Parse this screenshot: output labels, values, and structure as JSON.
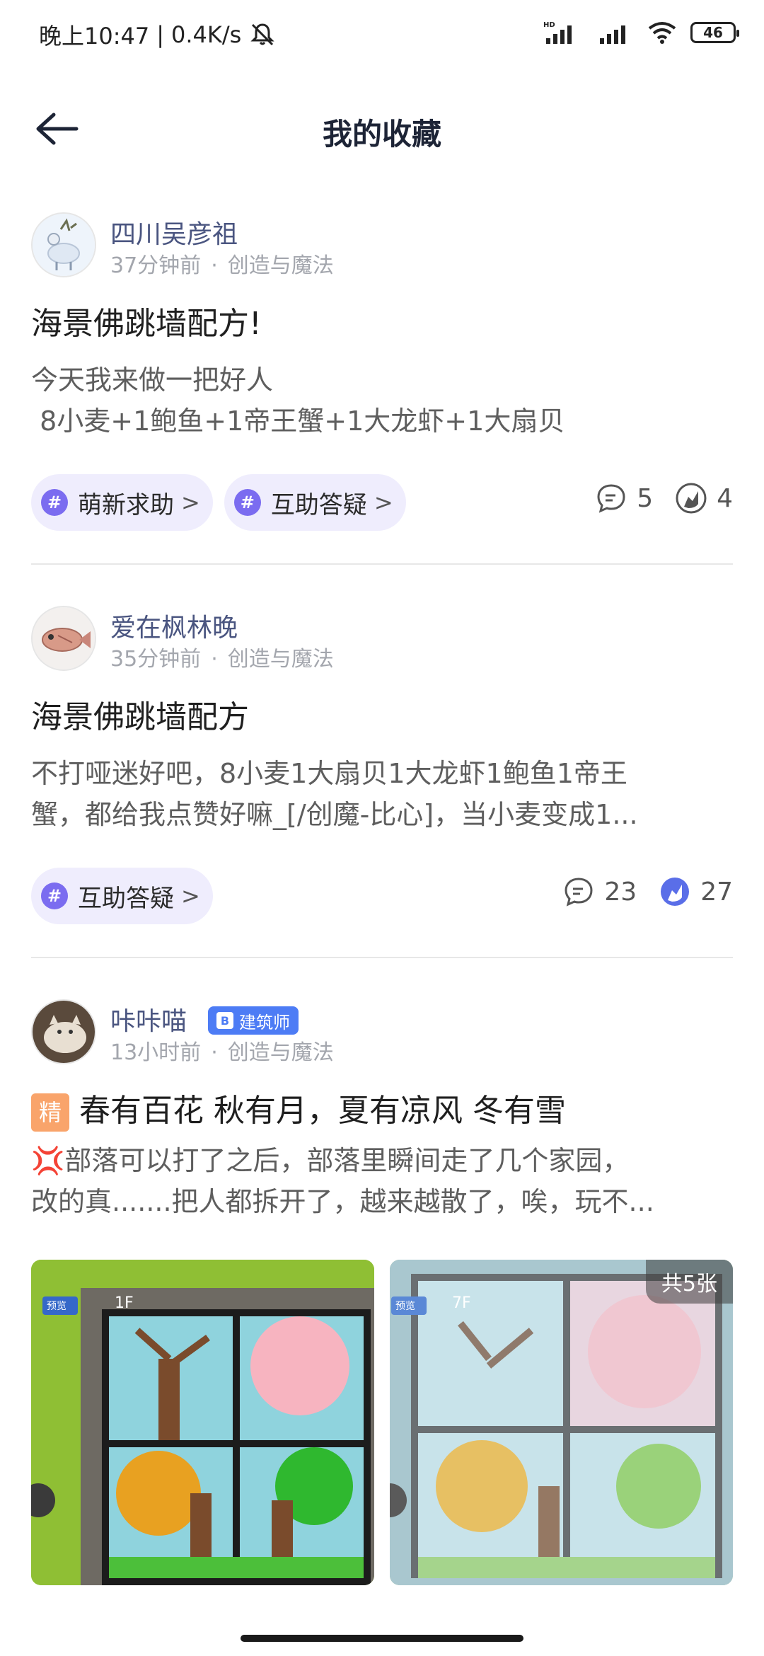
{
  "status_bar": {
    "time": "晚上10:47",
    "speed": "0.4K/s",
    "battery": "46",
    "signal_label": "HD"
  },
  "header": {
    "title": "我的收藏"
  },
  "posts": [
    {
      "author": "四川吴彦祖",
      "time_ago": "37分钟前",
      "dot": "·",
      "category": "创造与魔法",
      "title": "海景佛跳墙配方!",
      "body": [
        "今天我来做一把好人",
        " 8小麦+1鲍鱼+1帝王蟹+1大龙虾+1大扇贝"
      ],
      "tags": [
        "萌新求助",
        "互助答疑"
      ],
      "comments": "5",
      "likes": "4"
    },
    {
      "author": "爱在枫林晚",
      "time_ago": "35分钟前",
      "dot": "·",
      "category": "创造与魔法",
      "title": "海景佛跳墙配方",
      "body": [
        "不打哑迷好吧，8小麦1大扇贝1大龙虾1鲍鱼1帝王",
        "蟹，都给我点赞好嘛_[/创魔-比心]，当小麦变成1..."
      ],
      "tags": [
        "互助答疑"
      ],
      "comments": "23",
      "likes": "27"
    },
    {
      "author": "咔咔喵",
      "badge": "建筑师",
      "time_ago": "13小时前",
      "dot": "·",
      "category": "创造与魔法",
      "jing": "精",
      "title": "春有百花 秋有月，夏有凉风 冬有雪",
      "body": [
        "💢部落可以打了之后，部落里瞬间走了几个家园，",
        "改的真.......把人都拆开了，越来越散了，唉，玩不..."
      ],
      "image_count": "共5张",
      "image_labels": [
        "预览",
        "1F",
        "预览",
        "7F"
      ]
    }
  ],
  "colors": {
    "accent": "#7b6cf0",
    "tag_bg": "#efedfd",
    "author": "#4a5580",
    "meta": "#a3a6ad",
    "jing": "#f9a46b",
    "badge": "#4d7cf5"
  }
}
